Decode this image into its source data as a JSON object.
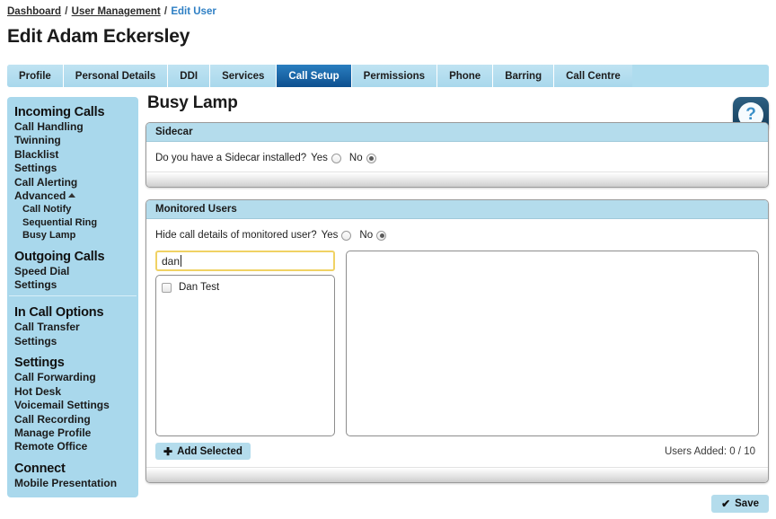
{
  "breadcrumb": {
    "items": [
      {
        "label": "Dashboard",
        "current": false
      },
      {
        "label": "User Management",
        "current": false
      },
      {
        "label": "Edit User",
        "current": true
      }
    ],
    "separator": "/"
  },
  "page_title": "Edit Adam Eckersley",
  "tabs": [
    {
      "label": "Profile",
      "active": false
    },
    {
      "label": "Personal Details",
      "active": false
    },
    {
      "label": "DDI",
      "active": false
    },
    {
      "label": "Services",
      "active": false
    },
    {
      "label": "Call Setup",
      "active": true
    },
    {
      "label": "Permissions",
      "active": false
    },
    {
      "label": "Phone",
      "active": false
    },
    {
      "label": "Barring",
      "active": false
    },
    {
      "label": "Call Centre",
      "active": false
    }
  ],
  "sidebar": {
    "groups": [
      {
        "heading": "Incoming Calls",
        "items": [
          {
            "label": "Call Handling",
            "sub": false,
            "caret": false
          },
          {
            "label": "Twinning",
            "sub": false,
            "caret": false
          },
          {
            "label": "Blacklist",
            "sub": false,
            "caret": false
          },
          {
            "label": "Settings",
            "sub": false,
            "caret": false
          },
          {
            "label": "Call Alerting",
            "sub": false,
            "caret": false
          },
          {
            "label": "Advanced",
            "sub": false,
            "caret": true
          },
          {
            "label": "Call Notify",
            "sub": true,
            "caret": false
          },
          {
            "label": "Sequential Ring",
            "sub": true,
            "caret": false
          },
          {
            "label": "Busy Lamp",
            "sub": true,
            "caret": false
          }
        ],
        "divider_after": false
      },
      {
        "heading": "Outgoing Calls",
        "items": [
          {
            "label": "Speed Dial",
            "sub": false,
            "caret": false
          },
          {
            "label": "Settings",
            "sub": false,
            "caret": false
          }
        ],
        "divider_after": true
      },
      {
        "heading": "In Call Options",
        "items": [
          {
            "label": "Call Transfer",
            "sub": false,
            "caret": false
          },
          {
            "label": "Settings",
            "sub": false,
            "caret": false
          }
        ],
        "divider_after": false
      },
      {
        "heading": "Settings",
        "items": [
          {
            "label": "Call Forwarding",
            "sub": false,
            "caret": false
          },
          {
            "label": "Hot Desk",
            "sub": false,
            "caret": false
          },
          {
            "label": "Voicemail Settings",
            "sub": false,
            "caret": false
          },
          {
            "label": "Call Recording",
            "sub": false,
            "caret": false
          },
          {
            "label": "Manage Profile",
            "sub": false,
            "caret": false
          },
          {
            "label": "Remote Office",
            "sub": false,
            "caret": false
          }
        ],
        "divider_after": false
      },
      {
        "heading": "Connect",
        "items": [
          {
            "label": "Mobile Presentation",
            "sub": false,
            "caret": false
          }
        ],
        "divider_after": false
      }
    ]
  },
  "main": {
    "title": "Busy Lamp",
    "help_label": "?",
    "sidecar": {
      "header": "Sidecar",
      "question": "Do you have a Sidecar installed?",
      "yes_label": "Yes",
      "no_label": "No",
      "selected": "No"
    },
    "monitored_users": {
      "header": "Monitored Users",
      "question": "Hide call details of monitored user?",
      "yes_label": "Yes",
      "no_label": "No",
      "selected": "No",
      "search_value": "dan",
      "search_placeholder": "",
      "available_users": [
        {
          "name": "Dan Test",
          "checked": false
        }
      ],
      "added_users": [],
      "add_button_label": "Add Selected",
      "add_button_icon": "plus-icon",
      "users_added_text": "Users Added: 0 / 10"
    },
    "save_label": "Save",
    "save_icon": "check-icon"
  },
  "colors": {
    "accent_light_blue": "#b4dcec",
    "tab_bar": "#a9d8ec",
    "active_tab": "#1d6fb8",
    "link_blue": "#2e7fc4",
    "focus_yellow": "#f0d264"
  }
}
